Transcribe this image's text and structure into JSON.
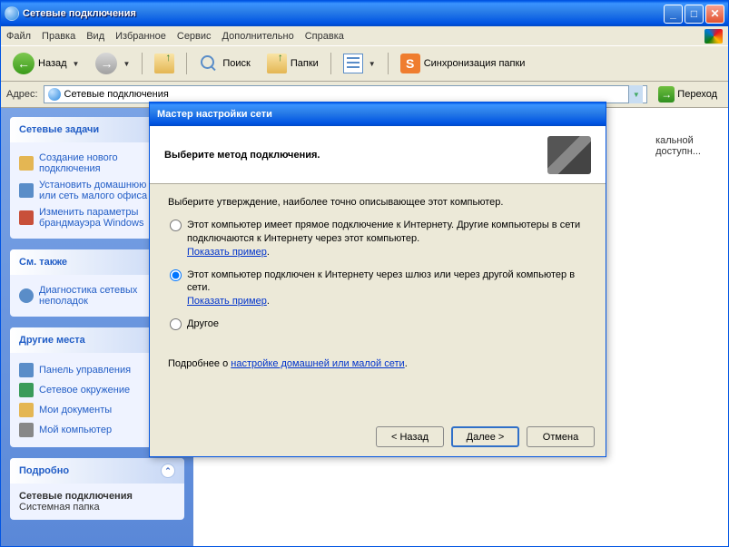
{
  "window": {
    "title": "Сетевые подключения"
  },
  "menu": {
    "file": "Файл",
    "edit": "Правка",
    "view": "Вид",
    "favorites": "Избранное",
    "tools": "Сервис",
    "advanced": "Дополнительно",
    "help": "Справка"
  },
  "toolbar": {
    "back": "Назад",
    "search": "Поиск",
    "folders": "Папки",
    "sync": "Синхронизация папки"
  },
  "address": {
    "label": "Адрес:",
    "value": "Сетевые подключения",
    "go": "Переход"
  },
  "sidebar": {
    "tasks": {
      "title": "Сетевые задачи",
      "items": [
        "Создание нового подключения",
        "Установить домашнюю сеть или сеть малого офиса",
        "Изменить параметры брандмауэра Windows"
      ]
    },
    "seealso": {
      "title": "См. также",
      "items": [
        "Диагностика сетевых неполадок"
      ]
    },
    "other": {
      "title": "Другие места",
      "items": [
        "Панель управления",
        "Сетевое окружение",
        "Мои документы",
        "Мой компьютер"
      ]
    },
    "details": {
      "title": "Подробно",
      "name": "Сетевые подключения",
      "type": "Системная папка"
    }
  },
  "main": {
    "item1": "кальной",
    "item2": "доступн..."
  },
  "modal": {
    "title": "Мастер настройки сети",
    "heading": "Выберите метод подключения.",
    "instruction": "Выберите утверждение, наиболее точно описывающее этот компьютер.",
    "opt1": "Этот компьютер имеет прямое подключение к Интернету. Другие компьютеры в сети подключаются к Интернету через этот компьютер.",
    "opt2": "Этот компьютер подключен к Интернету через шлюз или через другой компьютер в сети.",
    "opt3": "Другое",
    "example_link": "Показать пример",
    "info_prefix": "Подробнее о ",
    "info_link": "настройке домашней или малой сети",
    "info_suffix": ".",
    "btn_back": "< Назад",
    "btn_next": "Далее >",
    "btn_cancel": "Отмена"
  }
}
